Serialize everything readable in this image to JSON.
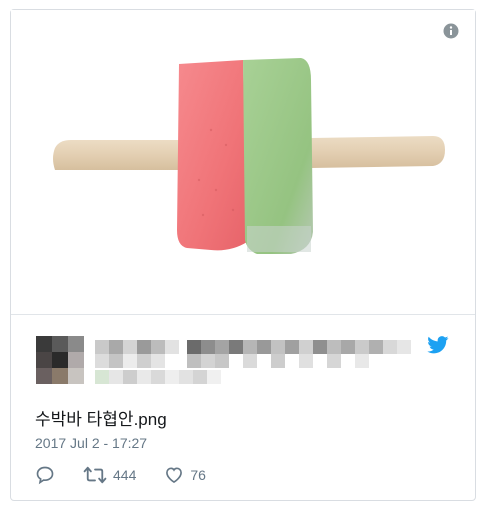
{
  "tweet": {
    "text": "수박바 타협안.png",
    "date": "2017 Jul 2 - 17:27",
    "retweets": "444",
    "likes": "76"
  },
  "icons": {
    "info": "info-icon",
    "twitter": "twitter-bird-icon",
    "reply": "reply-icon",
    "retweet": "retweet-icon",
    "like": "heart-icon"
  },
  "colors": {
    "twitter_blue": "#1da1f2",
    "muted": "#657786",
    "text": "#14171a",
    "watermelon_red": "#f27a7e",
    "melon_green": "#9cc88a"
  }
}
